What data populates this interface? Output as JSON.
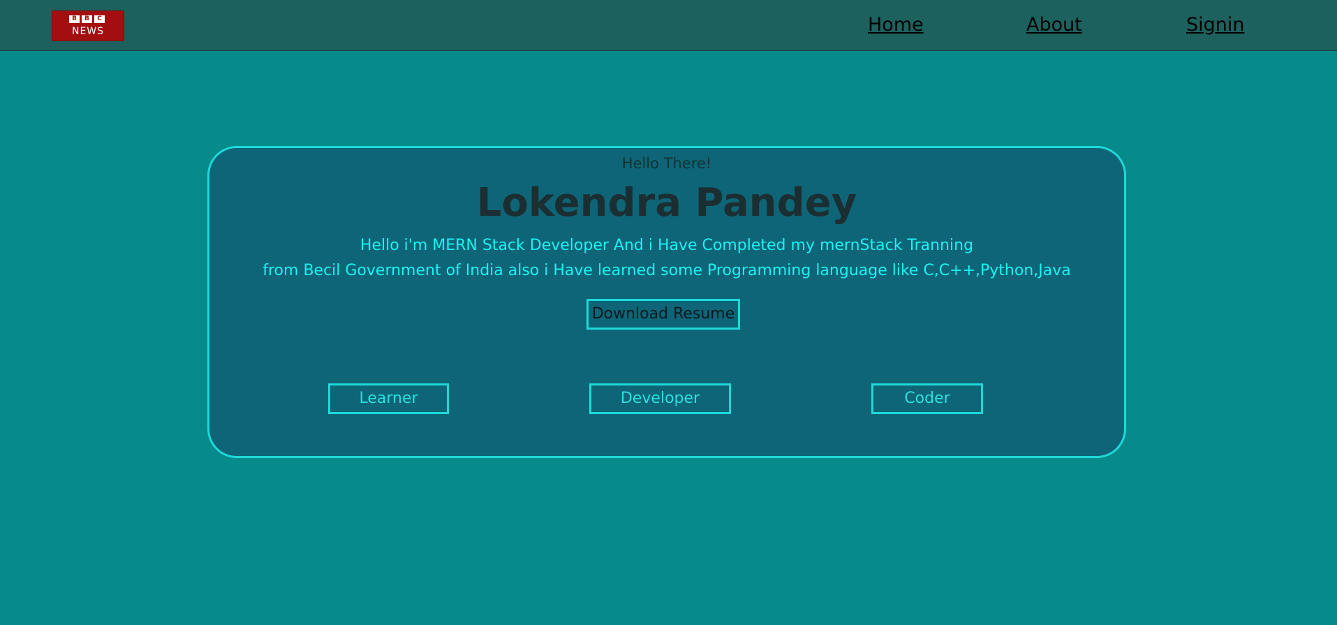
{
  "navbar": {
    "logo": {
      "letters": [
        "B",
        "B",
        "C"
      ],
      "word": "NEWS"
    },
    "links": [
      {
        "label": "Home"
      },
      {
        "label": "About"
      },
      {
        "label": "Signin"
      }
    ]
  },
  "hero": {
    "greeting": "Hello There!",
    "name": "Lokendra Pandey",
    "bio_line1": "Hello i'm MERN Stack Developer And i Have Completed my mernStack Tranning",
    "bio_line2": "from Becil Government of India also i Have learned some Programming language like C,C++,Python,Java",
    "download_label": "Download Resume",
    "tags": [
      {
        "label": "Learner"
      },
      {
        "label": "Developer"
      },
      {
        "label": "Coder"
      }
    ]
  },
  "colors": {
    "page_bg": "#068a8a",
    "navbar_bg": "#1d615e",
    "card_bg": "#0e6577",
    "accent": "#1ed9d9",
    "bio_text": "#1cf2f2",
    "logo_red": "#a30f10"
  }
}
